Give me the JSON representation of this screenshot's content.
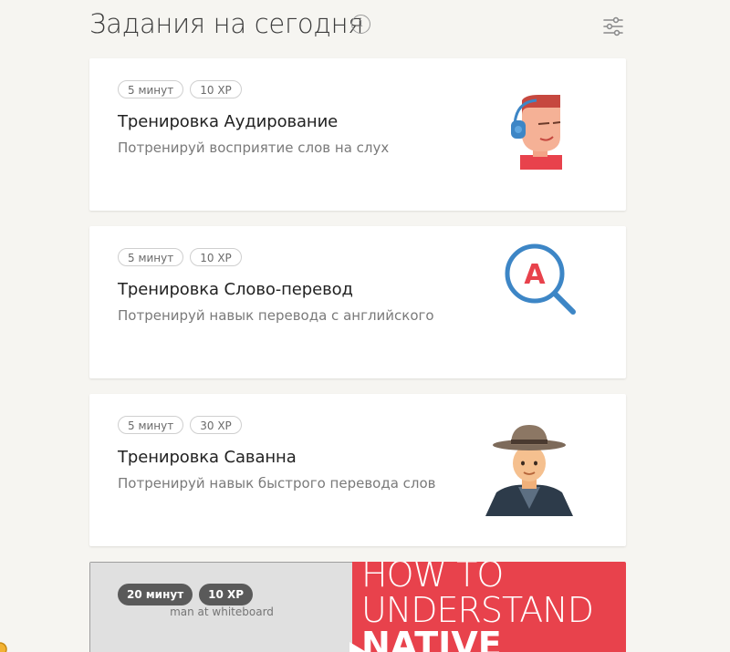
{
  "header": {
    "title": "Задания на сегодня",
    "info_glyph": "i"
  },
  "cards": [
    {
      "badges": [
        "5 минут",
        "10 XP"
      ],
      "title": "Тренировка Аудирование",
      "description": "Потренируй восприятие слов на слух",
      "icon": "listening-person-icon"
    },
    {
      "badges": [
        "5 минут",
        "10 XP"
      ],
      "title": "Тренировка Слово-перевод",
      "description": "Потренируй навык перевода с английского",
      "icon": "magnifier-letter-icon",
      "icon_letter": "A"
    },
    {
      "badges": [
        "5 минут",
        "30 XP"
      ],
      "title": "Тренировка Саванна",
      "description": "Потренируй навык быстрого перевода слов",
      "icon": "explorer-hat-icon"
    }
  ],
  "video": {
    "badges": [
      "20 минут",
      "10 XP"
    ],
    "thumbnail_label": "man at whiteboard",
    "title_lines": [
      "HOW TO",
      "UNDERSTAND",
      "NATIVE"
    ],
    "icon": "play-icon"
  },
  "colors": {
    "background": "#f6f5f1",
    "accent_blue": "#3d86c6",
    "accent_red": "#e8424c",
    "card_bg": "#ffffff"
  }
}
